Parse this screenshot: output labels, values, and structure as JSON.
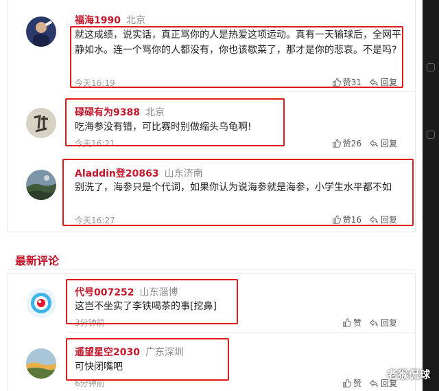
{
  "hot_comments": [
    {
      "username": "福海1990",
      "location": "北京",
      "text": "就这成绩，说实话，真正骂你的人是热爱这项运动。真有一天输球后，全网平静如水。连一个骂你的人都没有，你也该歇菜了，那才是你的悲哀。不是吗?",
      "time": "今天16:19",
      "like_label": "赞31",
      "reply_label": "回复"
    },
    {
      "username": "碌碌有为9388",
      "location": "北京",
      "text": "吃海参没有错，可比赛时别做缩头乌龟啊!",
      "time": "今天16:21",
      "like_label": "赞26",
      "reply_label": "回复"
    },
    {
      "username": "Aladdin登20863",
      "location": "山东济南",
      "text": "别洗了，海参只是个代词，如果你认为说海参就是海参，小学生水平都不如",
      "time": "今天16:27",
      "like_label": "赞16",
      "reply_label": "回复"
    }
  ],
  "section": {
    "title": "最新评论"
  },
  "latest_comments": [
    {
      "username": "代号007252",
      "location": "山东淄博",
      "text": "这岂不坐实了李铁喝茶的事[挖鼻]",
      "time": "3分钟前",
      "like_label": "赞",
      "reply_label": "回复"
    },
    {
      "username": "遥望星空2030",
      "location": "广东深圳",
      "text": "可快闭嘴吧",
      "time": "6分钟前",
      "like_label": "赞",
      "reply_label": "回复"
    }
  ],
  "watermark": "老猴侃球",
  "colors": {
    "accent": "#c4162a",
    "highlight_box": "#e01a1a",
    "location": "#8a8a8a"
  }
}
